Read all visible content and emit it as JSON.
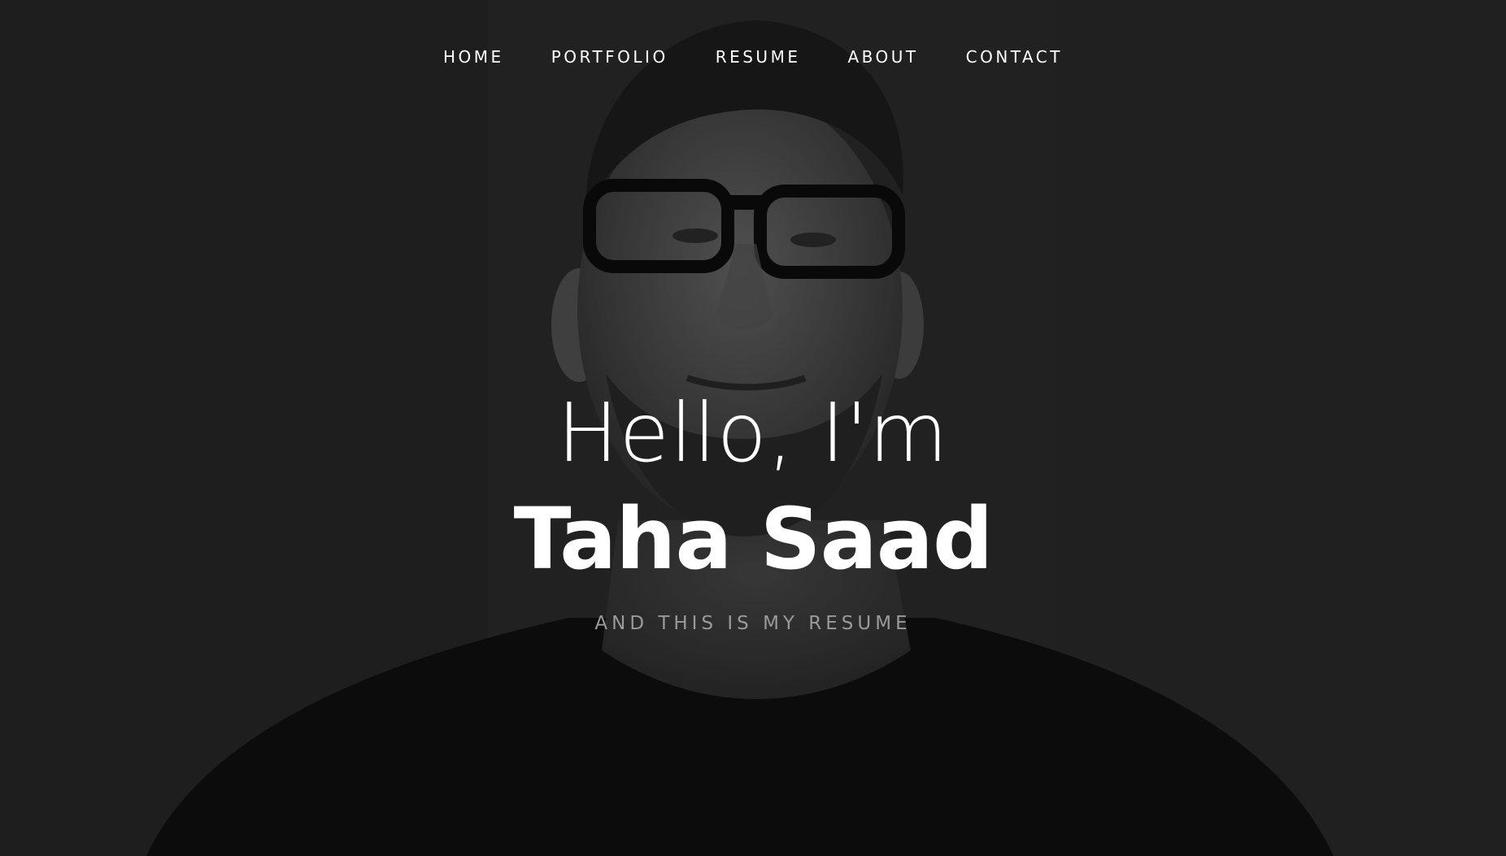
{
  "nav": {
    "items": [
      {
        "label": "HOME"
      },
      {
        "label": "PORTFOLIO"
      },
      {
        "label": "RESUME"
      },
      {
        "label": "ABOUT"
      },
      {
        "label": "CONTACT"
      }
    ]
  },
  "hero": {
    "greeting": "Hello, I'm",
    "name": "Taha Saad",
    "tagline": "AND THIS IS MY RESUME",
    "background": "dark grayscale portrait photo of person wearing glasses"
  },
  "colors": {
    "text": "#ffffff",
    "tagline": "#9a9a9a",
    "background": "#2b2b2b"
  }
}
